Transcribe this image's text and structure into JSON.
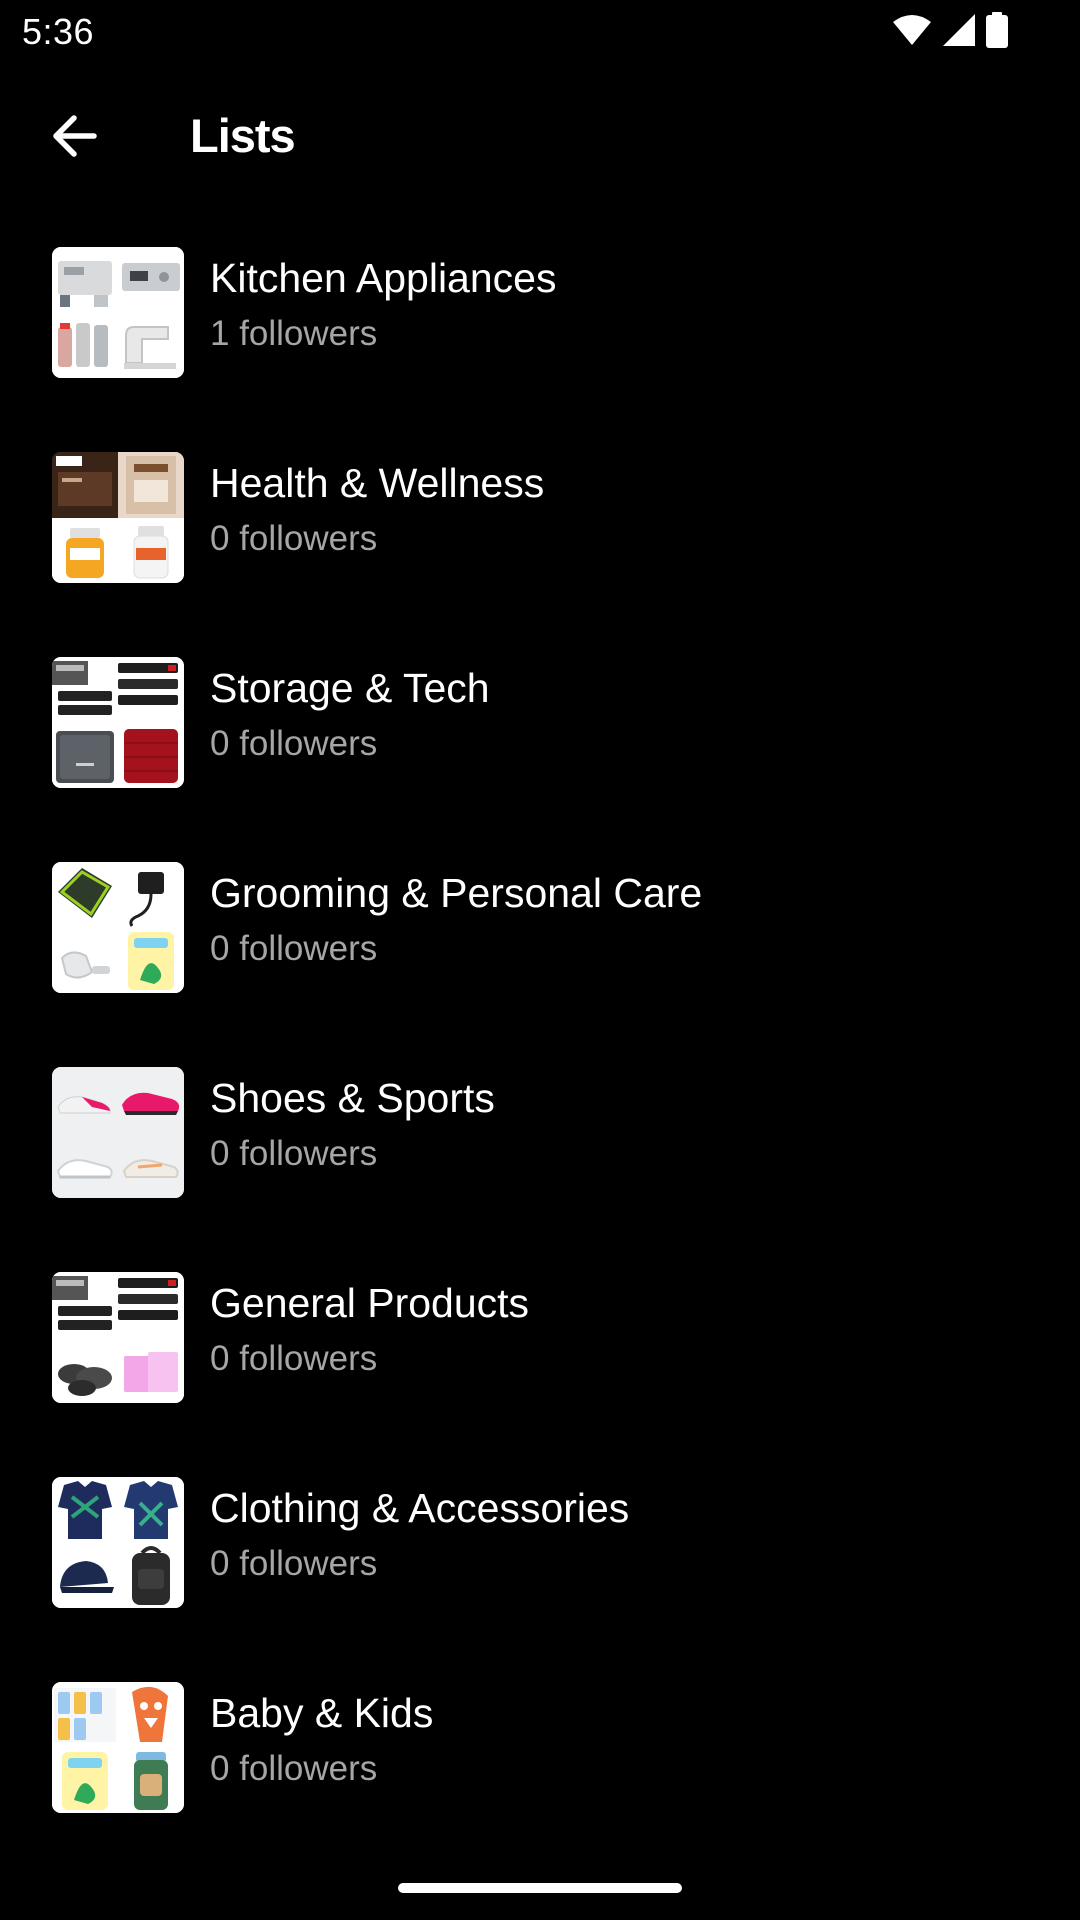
{
  "status_bar": {
    "time": "5:36",
    "icons": [
      "wifi-icon",
      "cellular-signal-icon",
      "battery-icon"
    ]
  },
  "app_bar": {
    "back_icon": "arrow-left-icon",
    "title": "Lists"
  },
  "colors": {
    "background": "#000000",
    "title_text": "#ffffff",
    "subtitle_text": "#a6a6a6",
    "thumbnail_background": "#ffffff"
  },
  "lists": [
    {
      "title": "Kitchen Appliances",
      "followers": "1 followers",
      "thumbnail": "kitchen-appliances-collage"
    },
    {
      "title": "Health & Wellness",
      "followers": "0 followers",
      "thumbnail": "health-wellness-collage"
    },
    {
      "title": "Storage & Tech",
      "followers": "0 followers",
      "thumbnail": "storage-tech-collage"
    },
    {
      "title": "Grooming & Personal Care",
      "followers": "0 followers",
      "thumbnail": "grooming-personal-care-collage"
    },
    {
      "title": "Shoes & Sports",
      "followers": "0 followers",
      "thumbnail": "shoes-sports-collage"
    },
    {
      "title": "General Products",
      "followers": "0 followers",
      "thumbnail": "general-products-collage"
    },
    {
      "title": "Clothing & Accessories",
      "followers": "0 followers",
      "thumbnail": "clothing-accessories-collage"
    },
    {
      "title": "Baby & Kids",
      "followers": "0 followers",
      "thumbnail": "baby-kids-collage"
    }
  ]
}
